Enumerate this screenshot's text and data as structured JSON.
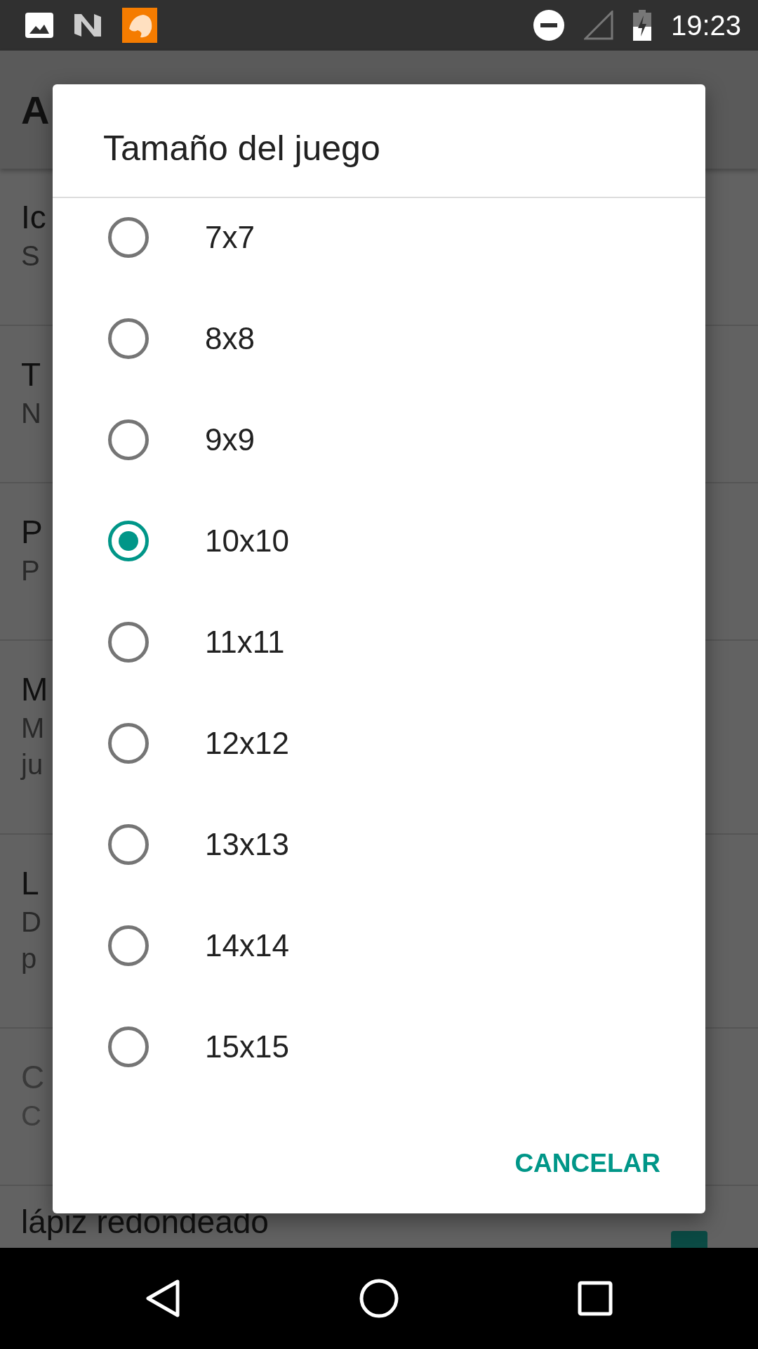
{
  "status_bar": {
    "time": "19:23"
  },
  "app_bar": {
    "title": "A"
  },
  "settings": [
    {
      "kind": "pref",
      "title": "Ic",
      "summary": [
        "S"
      ],
      "disabled": false
    },
    {
      "kind": "pref",
      "title": "T",
      "summary": [
        "N"
      ],
      "disabled": false
    },
    {
      "kind": "pref",
      "title": "P",
      "summary": [
        "P"
      ],
      "disabled": false
    },
    {
      "kind": "pref",
      "title": "M",
      "summary": [
        "M",
        "ju"
      ],
      "disabled": false
    },
    {
      "kind": "pref",
      "title": "L",
      "summary": [
        "D",
        "p"
      ],
      "disabled": false
    },
    {
      "kind": "pref",
      "title": "C",
      "summary": [
        "C"
      ],
      "disabled": true
    },
    {
      "kind": "check",
      "title": "lápiz redondeado",
      "checked": true
    }
  ],
  "dialog": {
    "title": "Tamaño del juego",
    "options": [
      {
        "label": "7x7",
        "selected": false
      },
      {
        "label": "8x8",
        "selected": false
      },
      {
        "label": "9x9",
        "selected": false
      },
      {
        "label": "10x10",
        "selected": true
      },
      {
        "label": "11x11",
        "selected": false
      },
      {
        "label": "12x12",
        "selected": false
      },
      {
        "label": "13x13",
        "selected": false
      },
      {
        "label": "14x14",
        "selected": false
      },
      {
        "label": "15x15",
        "selected": false
      }
    ],
    "buttons": [
      "CANCELAR"
    ]
  }
}
